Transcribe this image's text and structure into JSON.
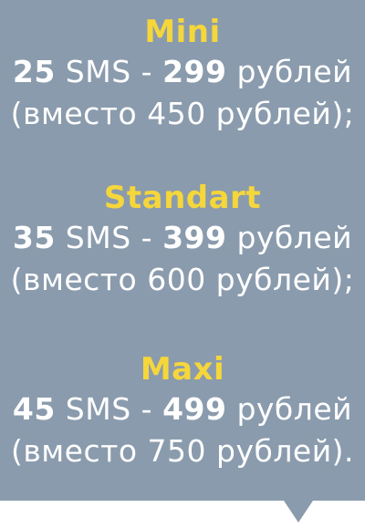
{
  "colors": {
    "background": "#8a9bad",
    "accent": "#f5d63b",
    "text": "#ffffff"
  },
  "plans": [
    {
      "name": "Mini",
      "sms_count": "25",
      "sms_label": "SMS -",
      "price": "299",
      "price_unit": "рублей",
      "old_price_note": "(вместо 450 рублей);"
    },
    {
      "name": "Standart",
      "sms_count": "35",
      "sms_label": "SMS -",
      "price": "399",
      "price_unit": "рублей",
      "old_price_note": "(вместо 600 рублей);"
    },
    {
      "name": "Maxi",
      "sms_count": "45",
      "sms_label": "SMS -",
      "price": "499",
      "price_unit": "рублей",
      "old_price_note": "(вместо 750 рублей)."
    }
  ]
}
